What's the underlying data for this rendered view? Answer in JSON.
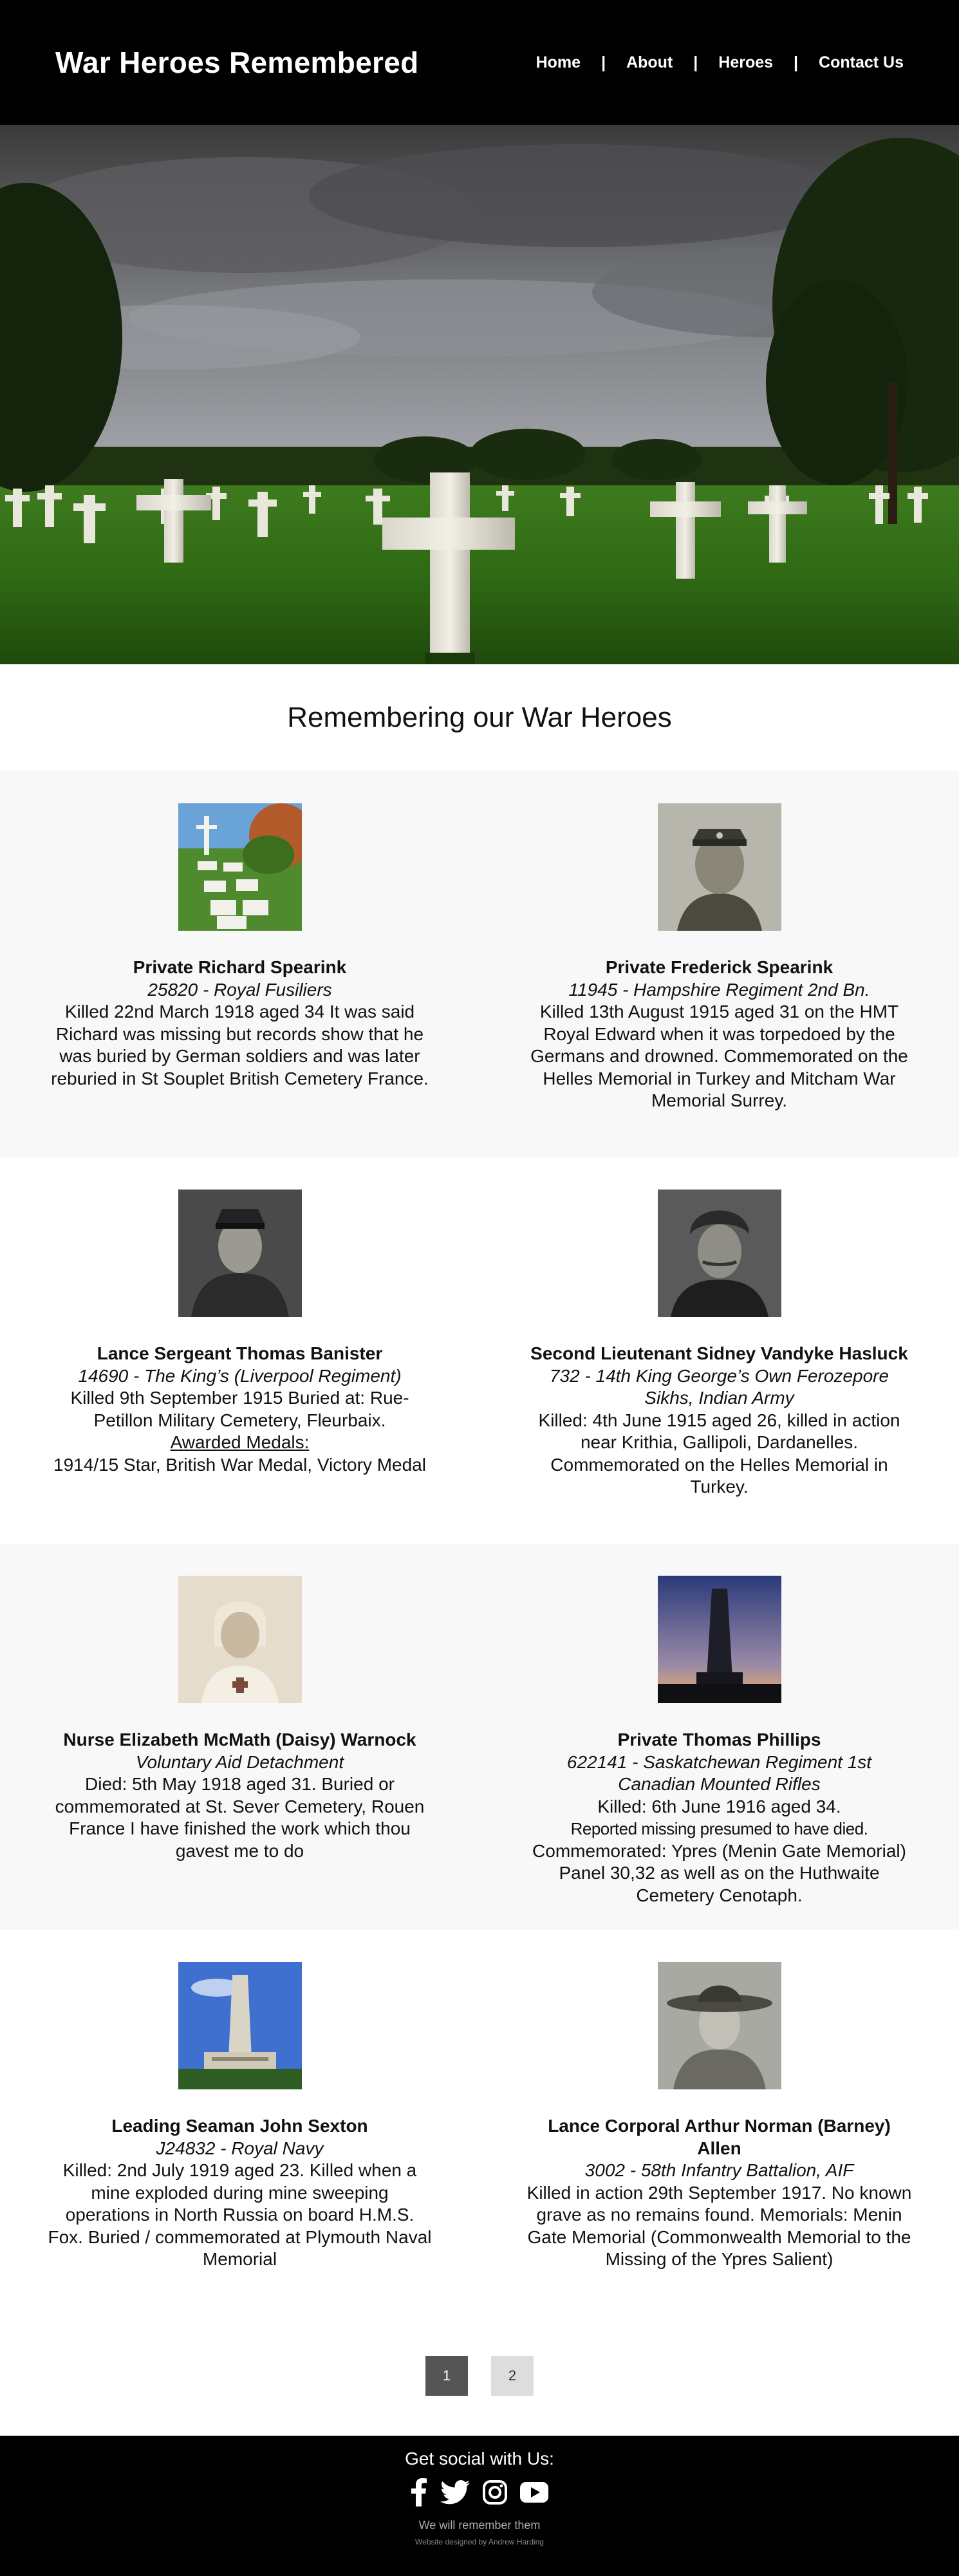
{
  "header": {
    "title": "War Heroes Remembered",
    "nav": [
      "Home",
      "About",
      "Heroes",
      "Contact Us"
    ],
    "separator": "|"
  },
  "intro": {
    "heading": "Remembering our War Heroes"
  },
  "heroes": [
    {
      "name": "Private Richard Spearink",
      "unit": "25820 - Royal Fusiliers",
      "details": "Killed 22nd March 1918 aged 34 It was said Richard was missing but records show that he was buried by German soldiers and was later reburied in St Souplet British Cemetery France."
    },
    {
      "name": "Private Frederick Spearink",
      "unit": "11945 - Hampshire Regiment 2nd Bn.",
      "details": "Killed 13th August 1915 aged 31 on the HMT Royal Edward when it was torpedoed by the Germans and drowned. Commemorated on the Helles Memorial in Turkey and Mitcham War Memorial Surrey."
    },
    {
      "name": "Lance Sergeant Thomas Banister",
      "unit": "14690 - The King’s (Liverpool Regiment)",
      "details": "Killed 9th September 1915 Buried at: Rue-Petillon Military Cemetery, Fleurbaix.",
      "medals_heading": "Awarded Medals:",
      "medals": "1914/15 Star, British War Medal, Victory Medal"
    },
    {
      "name": "Second Lieutenant Sidney Vandyke Hasluck",
      "unit": "732 - 14th King George’s Own Ferozepore Sikhs, Indian Army",
      "details": "Killed: 4th June 1915 aged 26, killed in action near Krithia, Gallipoli, Dardanelles. Commemorated on the Helles Memorial in Turkey."
    },
    {
      "name": "Nurse Elizabeth McMath (Daisy) Warnock",
      "unit": "Voluntary Aid Detachment",
      "details": "Died: 5th May 1918 aged 31. Buried or commemorated at St. Sever Cemetery, Rouen France I have finished the work which thou gavest me to do"
    },
    {
      "name": "Private Thomas Phillips",
      "unit": "622141 - Saskatchewan Regiment 1st Canadian Mounted Rifles",
      "details_1": "Killed: 6th June 1916 aged 34.",
      "details_2": "Reported missing presumed to have died.",
      "details_3": "Commemorated: Ypres (Menin Gate Memorial) Panel 30,32 as well as on the Huthwaite Cemetery Cenotaph."
    },
    {
      "name": "Leading Seaman John Sexton",
      "unit": "J24832 - Royal Navy",
      "details": "Killed: 2nd July 1919 aged 23. Killed when a mine exploded during mine sweeping operations in North Russia on board H.M.S. Fox. Buried / commemorated at Plymouth Naval Memorial"
    },
    {
      "name": "Lance Corporal Arthur Norman (Barney) Allen",
      "unit": "3002 - 58th Infantry Battalion, AIF",
      "details": "Killed in action 29th September 1917. No known grave as no remains found. Memorials: Menin Gate Memorial (Commonwealth Memorial to the Missing of the Ypres Salient)"
    }
  ],
  "pagination": {
    "pages": [
      "1",
      "2"
    ],
    "current": "1"
  },
  "footer": {
    "social_heading": "Get social with Us:",
    "socials": [
      "facebook-icon",
      "twitter-icon",
      "instagram-icon",
      "youtube-icon"
    ],
    "tagline": "We will remember them",
    "credit": "Website designed by Andrew Harding"
  },
  "colors": {
    "header_bg": "#000000",
    "band_grey": "#f8f8f8",
    "page_active": "#555555",
    "page_inactive": "#dddddd"
  }
}
